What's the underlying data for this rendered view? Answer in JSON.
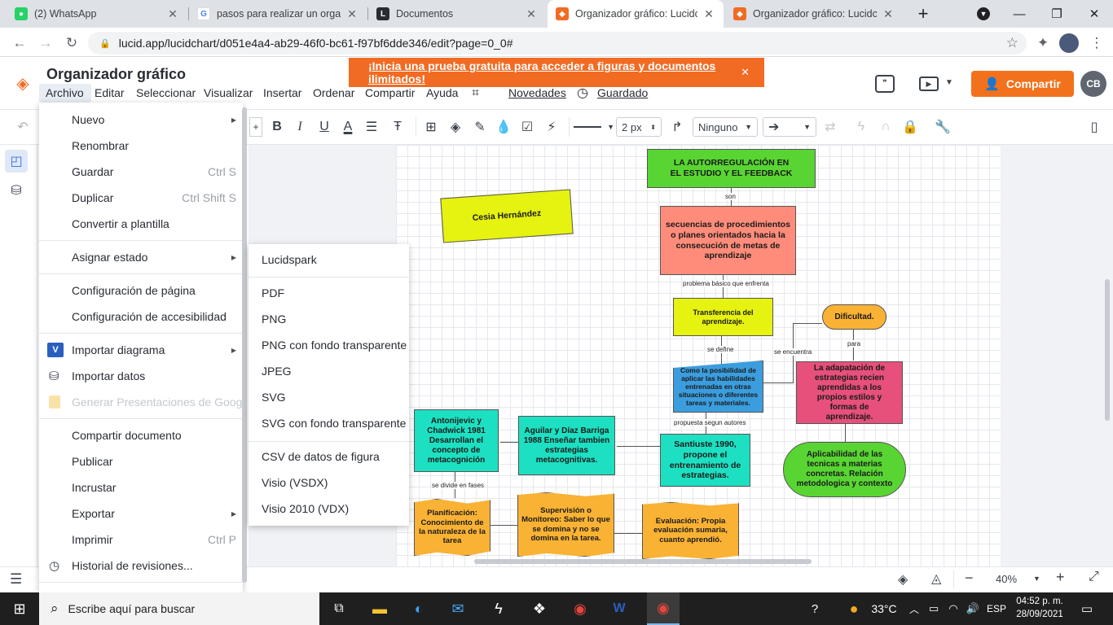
{
  "browser": {
    "tabs": [
      {
        "title": "(2) WhatsApp",
        "close": "✕"
      },
      {
        "title": "pasos para realizar un organi",
        "close": "✕"
      },
      {
        "title": "Documentos",
        "close": "✕"
      },
      {
        "title": "Organizador gráfico: Lucidch",
        "close": "✕"
      },
      {
        "title": "Organizador gráfico: Lucidch",
        "close": "✕"
      }
    ],
    "new_tab": "+",
    "url": "lucid.app/lucidchart/d051e4a4-ab29-46f0-bc61-f97bf6dde346/edit?page=0_0#"
  },
  "app": {
    "title": "Organizador gráfico",
    "menubar": [
      "Archivo",
      "Editar",
      "Seleccionar",
      "Visualizar",
      "Insertar",
      "Ordenar",
      "Compartir",
      "Ayuda"
    ],
    "novedades": "Novedades",
    "guardado": "Guardado",
    "banner": "¡Inicia una prueba gratuita para acceder a figuras y documentos ilimitados!",
    "banner_close": "✕",
    "share_label": "Compartir",
    "avatar_initials": "CB"
  },
  "toolbar": {
    "line_width": "2 px",
    "arrow_start": "Ninguno"
  },
  "archivo_menu": {
    "items": [
      {
        "label": "Nuevo",
        "shortcut": "",
        "submenu": true
      },
      {
        "label": "Renombrar",
        "shortcut": ""
      },
      {
        "label": "Guardar",
        "shortcut": "Ctrl S"
      },
      {
        "label": "Duplicar",
        "shortcut": "Ctrl Shift S"
      },
      {
        "label": "Convertir a plantilla",
        "shortcut": ""
      },
      {
        "label": "Asignar estado",
        "shortcut": "",
        "submenu": true
      },
      {
        "label": "Configuración de página",
        "shortcut": ""
      },
      {
        "label": "Configuración de accesibilidad",
        "shortcut": ""
      },
      {
        "label": "Importar diagrama",
        "shortcut": "",
        "submenu": true
      },
      {
        "label": "Importar datos",
        "shortcut": ""
      },
      {
        "label": "Generar Presentaciones de Google",
        "shortcut": "",
        "disabled": true
      },
      {
        "label": "Compartir documento",
        "shortcut": ""
      },
      {
        "label": "Publicar",
        "shortcut": ""
      },
      {
        "label": "Incrustar",
        "shortcut": ""
      },
      {
        "label": "Exportar",
        "shortcut": "",
        "submenu": true
      },
      {
        "label": "Imprimir",
        "shortcut": "Ctrl P"
      },
      {
        "label": "Historial de revisiones...",
        "shortcut": ""
      }
    ]
  },
  "export_submenu": {
    "items": [
      "Lucidspark",
      "PDF",
      "PNG",
      "PNG con fondo transparente",
      "JPEG",
      "SVG",
      "SVG con fondo transparente",
      "CSV de datos de figura",
      "Visio (VSDX)",
      "Visio 2010 (VDX)"
    ]
  },
  "diagram": {
    "shapes": {
      "title": "LA AUTORREGULACIÓN EN EL ESTUDIO Y EL FEEDBACK",
      "author": "Cesia Hernández",
      "secuencias": "secuencias de procedimientos o planes orientados hacia la consecución de metas de aprendizaje",
      "transferencia": "Transferencia del aprendizaje.",
      "dificultad": "Dificultad.",
      "posibilidad": "Como la posibilidad de aplicar las habilidades entrenadas en otras situaciones o diferentes tareas y materiales.",
      "adaptacion": "La adapatación de estrategias recien aprendidas a los propios estilos y formas de aprendizaje.",
      "santiuste": "Santiuste 1990, propone el entrenamiento de estrategias.",
      "aguilar": "Aguilar y Díaz Barriga 1988 Enseñar tambien estrategias metacognitivas.",
      "antonijevic": "Antonijevic y Chadwick 1981 Desarrollan el concepto de metacognición",
      "aplicabilidad": "Aplicabilidad de las tecnicas a materias concretas. Relación metodologica y contexto",
      "planificacion": "Planificación: Conocimiento de la naturaleza de la tarea",
      "supervision": "Supervisión o Monitoreo: Saber lo que se domina y no se domina en la tarea.",
      "evaluacion": "Evaluación: Propia evaluación sumaria, cuanto aprendió."
    },
    "labels": {
      "son": "son",
      "problema": "problema básico que enfrenta",
      "se_define": "se define",
      "se_encuentra": "se encuentra",
      "para": "para",
      "propuesta": "propuesta segun autores",
      "se_divide": "se divide en fases"
    },
    "colors": {
      "green": "#58d532",
      "salmon": "#ff8c7a",
      "yellow": "#e6f20f",
      "orange": "#f9b233",
      "blue": "#3b9ddd",
      "pink": "#e6507a",
      "teal": "#1de0c2"
    }
  },
  "bottom": {
    "zoom": "40%"
  },
  "taskbar": {
    "search_placeholder": "Escribe aquí para buscar",
    "temperature": "33°C",
    "lang": "ESP",
    "time": "04:52 p. m.",
    "date": "28/09/2021"
  }
}
